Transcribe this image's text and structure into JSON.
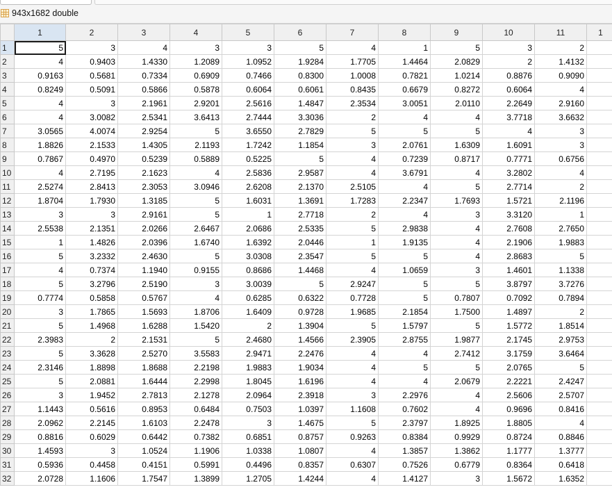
{
  "window": {
    "variable_title": "943x1682 double"
  },
  "icons": {
    "variable": "variable-grid-icon"
  },
  "columns": [
    "1",
    "2",
    "3",
    "4",
    "5",
    "6",
    "7",
    "8",
    "9",
    "10",
    "11",
    "1"
  ],
  "rows": [
    {
      "label": "1",
      "cells": [
        "5",
        "3",
        "4",
        "3",
        "3",
        "5",
        "4",
        "1",
        "5",
        "3",
        "2",
        ""
      ]
    },
    {
      "label": "2",
      "cells": [
        "4",
        "0.9403",
        "1.4330",
        "1.2089",
        "1.0952",
        "1.9284",
        "1.7705",
        "1.4464",
        "2.0829",
        "2",
        "1.4132",
        ""
      ]
    },
    {
      "label": "3",
      "cells": [
        "0.9163",
        "0.5681",
        "0.7334",
        "0.6909",
        "0.7466",
        "0.8300",
        "1.0008",
        "0.7821",
        "1.0214",
        "0.8876",
        "0.9090",
        ""
      ]
    },
    {
      "label": "4",
      "cells": [
        "0.8249",
        "0.5091",
        "0.5866",
        "0.5878",
        "0.6064",
        "0.6061",
        "0.8435",
        "0.6679",
        "0.8272",
        "0.6064",
        "4",
        ""
      ]
    },
    {
      "label": "5",
      "cells": [
        "4",
        "3",
        "2.1961",
        "2.9201",
        "2.5616",
        "1.4847",
        "2.3534",
        "3.0051",
        "2.0110",
        "2.2649",
        "2.9160",
        ""
      ]
    },
    {
      "label": "6",
      "cells": [
        "4",
        "3.0082",
        "2.5341",
        "3.6413",
        "2.7444",
        "3.3036",
        "2",
        "4",
        "4",
        "3.7718",
        "3.6632",
        ""
      ]
    },
    {
      "label": "7",
      "cells": [
        "3.0565",
        "4.0074",
        "2.9254",
        "5",
        "3.6550",
        "2.7829",
        "5",
        "5",
        "5",
        "4",
        "3",
        ""
      ]
    },
    {
      "label": "8",
      "cells": [
        "1.8826",
        "2.1533",
        "1.4305",
        "2.1193",
        "1.7242",
        "1.1854",
        "3",
        "2.0761",
        "1.6309",
        "1.6091",
        "3",
        ""
      ]
    },
    {
      "label": "9",
      "cells": [
        "0.7867",
        "0.4970",
        "0.5239",
        "0.5889",
        "0.5225",
        "5",
        "4",
        "0.7239",
        "0.8717",
        "0.7771",
        "0.6756",
        ""
      ]
    },
    {
      "label": "10",
      "cells": [
        "4",
        "2.7195",
        "2.1623",
        "4",
        "2.5836",
        "2.9587",
        "4",
        "3.6791",
        "4",
        "3.2802",
        "4",
        ""
      ]
    },
    {
      "label": "11",
      "cells": [
        "2.5274",
        "2.8413",
        "2.3053",
        "3.0946",
        "2.6208",
        "2.1370",
        "2.5105",
        "4",
        "5",
        "2.7714",
        "2",
        ""
      ]
    },
    {
      "label": "12",
      "cells": [
        "1.8704",
        "1.7930",
        "1.3185",
        "5",
        "1.6031",
        "1.3691",
        "1.7283",
        "2.2347",
        "1.7693",
        "1.5721",
        "2.1196",
        ""
      ]
    },
    {
      "label": "13",
      "cells": [
        "3",
        "3",
        "2.9161",
        "5",
        "1",
        "2.7718",
        "2",
        "4",
        "3",
        "3.3120",
        "1",
        ""
      ]
    },
    {
      "label": "14",
      "cells": [
        "2.5538",
        "2.1351",
        "2.0266",
        "2.6467",
        "2.0686",
        "2.5335",
        "5",
        "2.9838",
        "4",
        "2.7608",
        "2.7650",
        ""
      ]
    },
    {
      "label": "15",
      "cells": [
        "1",
        "1.4826",
        "2.0396",
        "1.6740",
        "1.6392",
        "2.0446",
        "1",
        "1.9135",
        "4",
        "2.1906",
        "1.9883",
        ""
      ]
    },
    {
      "label": "16",
      "cells": [
        "5",
        "3.2332",
        "2.4630",
        "5",
        "3.0308",
        "2.3547",
        "5",
        "5",
        "4",
        "2.8683",
        "5",
        ""
      ]
    },
    {
      "label": "17",
      "cells": [
        "4",
        "0.7374",
        "1.1940",
        "0.9155",
        "0.8686",
        "1.4468",
        "4",
        "1.0659",
        "3",
        "1.4601",
        "1.1338",
        ""
      ]
    },
    {
      "label": "18",
      "cells": [
        "5",
        "3.2796",
        "2.5190",
        "3",
        "3.0039",
        "5",
        "2.9247",
        "5",
        "5",
        "3.8797",
        "3.7276",
        ""
      ]
    },
    {
      "label": "19",
      "cells": [
        "0.7774",
        "0.5858",
        "0.5767",
        "4",
        "0.6285",
        "0.6322",
        "0.7728",
        "5",
        "0.7807",
        "0.7092",
        "0.7894",
        ""
      ]
    },
    {
      "label": "20",
      "cells": [
        "3",
        "1.7865",
        "1.5693",
        "1.8706",
        "1.6409",
        "0.9728",
        "1.9685",
        "2.1854",
        "1.7500",
        "1.4897",
        "2",
        ""
      ]
    },
    {
      "label": "21",
      "cells": [
        "5",
        "1.4968",
        "1.6288",
        "1.5420",
        "2",
        "1.3904",
        "5",
        "1.5797",
        "5",
        "1.5772",
        "1.8514",
        ""
      ]
    },
    {
      "label": "22",
      "cells": [
        "2.3983",
        "2",
        "2.1531",
        "5",
        "2.4680",
        "1.4566",
        "2.3905",
        "2.8755",
        "1.9877",
        "2.1745",
        "2.9753",
        ""
      ]
    },
    {
      "label": "23",
      "cells": [
        "5",
        "3.3628",
        "2.5270",
        "3.5583",
        "2.9471",
        "2.2476",
        "4",
        "4",
        "2.7412",
        "3.1759",
        "3.6464",
        ""
      ]
    },
    {
      "label": "24",
      "cells": [
        "2.3146",
        "1.8898",
        "1.8688",
        "2.2198",
        "1.9883",
        "1.9034",
        "4",
        "5",
        "5",
        "2.0765",
        "5",
        ""
      ]
    },
    {
      "label": "25",
      "cells": [
        "5",
        "2.0881",
        "1.6444",
        "2.2998",
        "1.8045",
        "1.6196",
        "4",
        "4",
        "2.0679",
        "2.2221",
        "2.4247",
        ""
      ]
    },
    {
      "label": "26",
      "cells": [
        "3",
        "1.9452",
        "2.7813",
        "2.1278",
        "2.0964",
        "2.3918",
        "3",
        "2.2976",
        "4",
        "2.5606",
        "2.5707",
        ""
      ]
    },
    {
      "label": "27",
      "cells": [
        "1.1443",
        "0.5616",
        "0.8953",
        "0.6484",
        "0.7503",
        "1.0397",
        "1.1608",
        "0.7602",
        "4",
        "0.9696",
        "0.8416",
        ""
      ]
    },
    {
      "label": "28",
      "cells": [
        "2.0962",
        "2.2145",
        "1.6103",
        "2.2478",
        "3",
        "1.4675",
        "5",
        "2.3797",
        "1.8925",
        "1.8805",
        "4",
        ""
      ]
    },
    {
      "label": "29",
      "cells": [
        "0.8816",
        "0.6029",
        "0.6442",
        "0.7382",
        "0.6851",
        "0.8757",
        "0.9263",
        "0.8384",
        "0.9929",
        "0.8724",
        "0.8846",
        ""
      ]
    },
    {
      "label": "30",
      "cells": [
        "1.4593",
        "3",
        "1.0524",
        "1.1906",
        "1.0338",
        "1.0807",
        "4",
        "1.3857",
        "1.3862",
        "1.1777",
        "1.3777",
        ""
      ]
    },
    {
      "label": "31",
      "cells": [
        "0.5936",
        "0.4458",
        "0.4151",
        "0.5991",
        "0.4496",
        "0.8357",
        "0.6307",
        "0.7526",
        "0.6779",
        "0.8364",
        "0.6418",
        ""
      ]
    },
    {
      "label": "32",
      "cells": [
        "2.0728",
        "1.1606",
        "1.7547",
        "1.3899",
        "1.2705",
        "1.4244",
        "4",
        "1.4127",
        "3",
        "1.5672",
        "1.6352",
        ""
      ]
    }
  ]
}
